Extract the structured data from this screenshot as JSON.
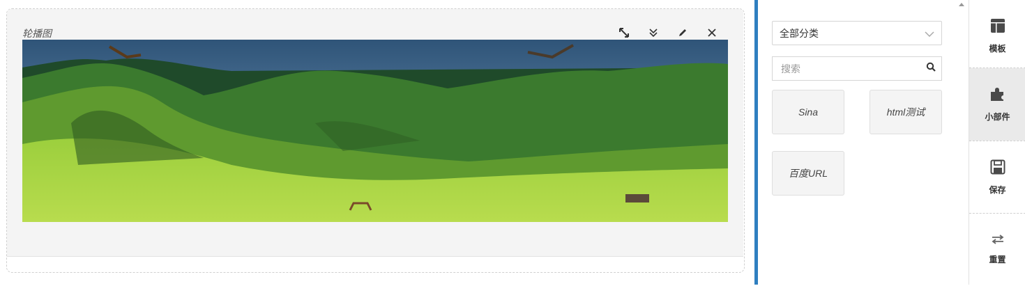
{
  "widget": {
    "title": "轮播图",
    "tools": [
      "resize-icon",
      "collapse-icon",
      "edit-icon",
      "close-icon"
    ]
  },
  "panel": {
    "category_select": "全部分类",
    "search_placeholder": "搜索",
    "tiles": [
      "Sina",
      "html测试",
      "百度URL"
    ]
  },
  "toolbar": {
    "template_label": "模板",
    "widgets_label": "小部件",
    "save_label": "保存",
    "reset_label": "重置"
  },
  "colors": {
    "accent_divider": "#2f7fc0",
    "tile_bg": "#f4f4f4",
    "active_toolbar_bg": "#eaeaea"
  }
}
